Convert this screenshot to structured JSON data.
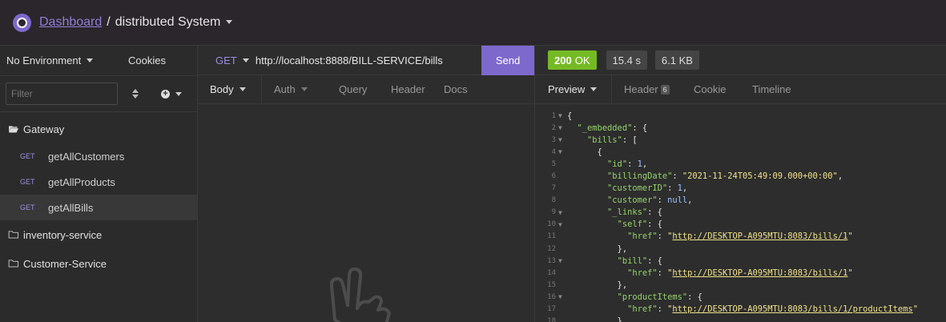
{
  "topbar": {
    "dashboard_link": "Dashboard",
    "separator": "/",
    "workspace": "distributed System"
  },
  "sidebar": {
    "environment": "No Environment",
    "cookies": "Cookies",
    "filter_placeholder": "Filter",
    "folders": [
      {
        "name": "Gateway",
        "requests": [
          {
            "method": "GET",
            "name": "getAllCustomers"
          },
          {
            "method": "GET",
            "name": "getAllProducts"
          },
          {
            "method": "GET",
            "name": "getAllBills"
          }
        ]
      },
      {
        "name": "inventory-service"
      },
      {
        "name": "Customer-Service"
      }
    ]
  },
  "request": {
    "method": "GET",
    "url": "http://localhost:8888/BILL-SERVICE/bills",
    "send_label": "Send",
    "tabs": [
      "Body",
      "Auth",
      "Query",
      "Header",
      "Docs"
    ]
  },
  "response": {
    "status_code": "200",
    "status_text": "OK",
    "time": "15.4 s",
    "size": "6.1 KB",
    "tabs": [
      "Preview",
      "Header",
      "Cookie",
      "Timeline"
    ],
    "header_count": "6",
    "line_numbers": [
      "1",
      "2",
      "3",
      "4",
      "5",
      "6",
      "7",
      "8",
      "9",
      "10",
      "11",
      "12",
      "13",
      "14",
      "15",
      "16",
      "17",
      "18"
    ],
    "keys": {
      "embedded": "\"_embedded\"",
      "bills": "\"bills\"",
      "id": "\"id\"",
      "billingDate": "\"billingDate\"",
      "customerID": "\"customerID\"",
      "customer": "\"customer\"",
      "links": "\"_links\"",
      "self": "\"self\"",
      "href": "\"href\"",
      "bill": "\"bill\"",
      "productItems": "\"productItems\""
    },
    "values": {
      "id": "1",
      "billingDate": "\"2021-11-24T05:49:09.000+00:00\"",
      "customerID": "1",
      "customer": "null",
      "self_href": "http://DESKTOP-A095MTU:8083/bills/1",
      "bill_href": "http://DESKTOP-A095MTU:8083/bills/1",
      "productItems_href": "http://DESKTOP-A095MTU:8083/bills/1/productItems"
    }
  },
  "colors": {
    "accent": "#7d69cb",
    "status_ok": "#75ba24",
    "json_key": "#96d36b",
    "json_string": "#f0e28a"
  }
}
